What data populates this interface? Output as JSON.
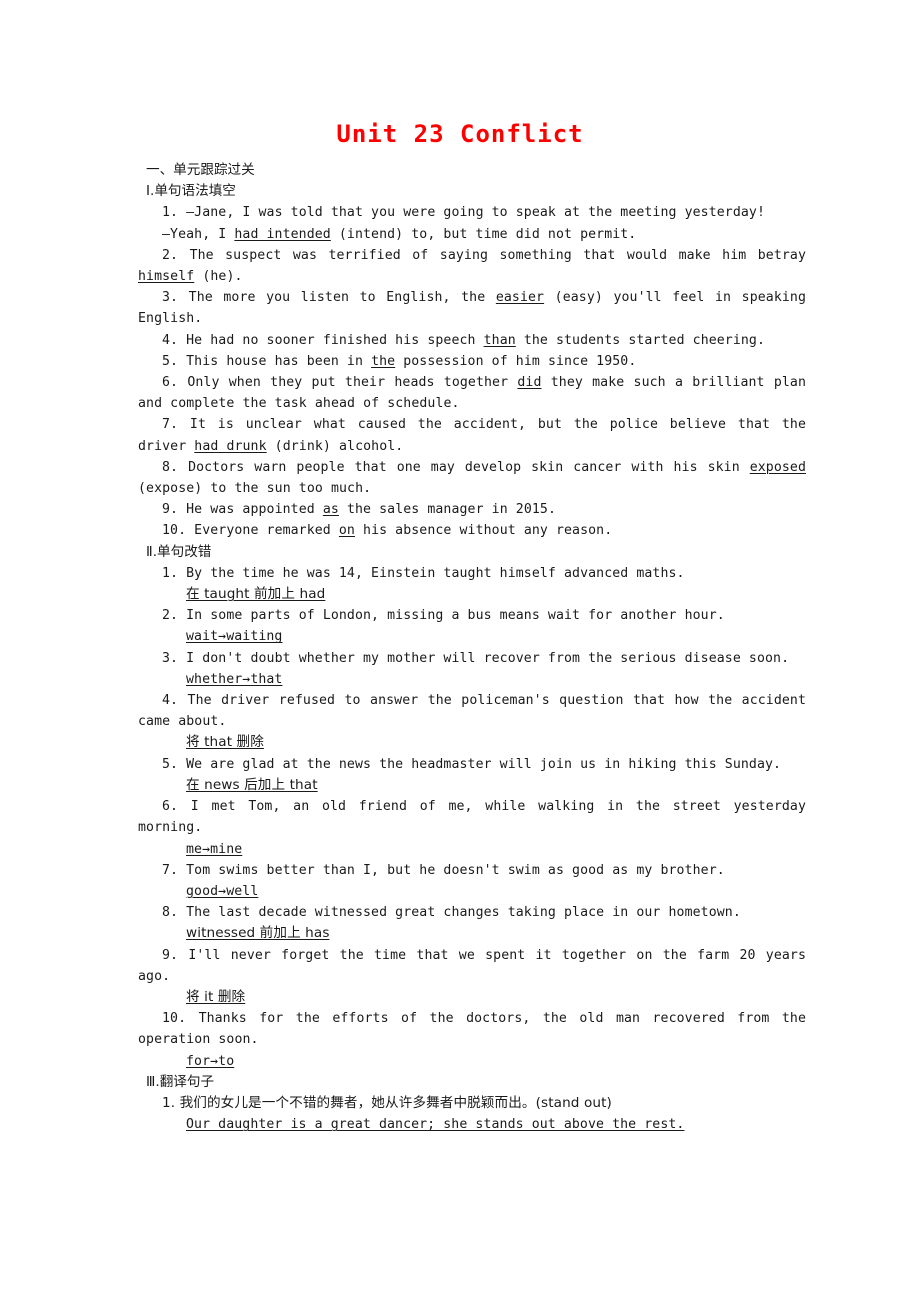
{
  "title": "Unit 23  Conflict",
  "title_color": "#ff0000",
  "section_one_heading": "一、单元跟踪过关",
  "part1": {
    "heading": "Ⅰ.单句语法填空",
    "items": [
      {
        "num": "1.",
        "text_before": "—Jane, I was told that you were going to speak at the meeting yesterday!",
        "line2_before": "—Yeah, I ",
        "answer": "had intended",
        "line2_after": " (intend) to, but time did not permit."
      },
      {
        "num": "2.",
        "before": "The suspect was terrified of saying something that would make him betray ",
        "answer": "himself",
        "after": " (he)."
      },
      {
        "num": "3.",
        "before": "The more you listen to English, the ",
        "answer": "easier",
        "after": " (easy) you'll feel in speaking English."
      },
      {
        "num": "4.",
        "before": "He had no sooner finished his speech  ",
        "answer": "than",
        "after": " the students started cheering."
      },
      {
        "num": "5.",
        "before": "This house has been in  ",
        "answer": "the",
        "after": " possession of him since 1950."
      },
      {
        "num": "6.",
        "before": "Only when they put their heads together ",
        "answer": "did",
        "after": " they make such a brilliant plan and complete the task ahead of schedule."
      },
      {
        "num": "7.",
        "before": "It is unclear what caused the accident, but the police believe that the driver ",
        "answer": "had drunk",
        "after": " (drink) alcohol."
      },
      {
        "num": "8.",
        "before": "Doctors warn people that one may develop skin cancer with his skin ",
        "answer": "exposed",
        "after": " (expose) to the sun too much."
      },
      {
        "num": "9.",
        "before": "He was appointed  ",
        "answer": "as",
        "after": " the sales manager in 2015."
      },
      {
        "num": "10.",
        "before": "Everyone remarked ",
        "answer": "on",
        "after": " his absence without any reason."
      }
    ]
  },
  "part2": {
    "heading": "Ⅱ.单句改错",
    "items": [
      {
        "num": "1.",
        "sentence": "By the time he was 14, Einstein taught himself advanced maths.",
        "answer": "在 taught 前加上 had",
        "answer_is_cn": true
      },
      {
        "num": "2.",
        "sentence": "In some parts of London, missing a bus means wait for another hour.",
        "answer": "wait→waiting",
        "answer_is_cn": false
      },
      {
        "num": "3.",
        "sentence": "I don't doubt whether my mother will recover from the serious disease soon.",
        "answer": "whether→that",
        "answer_is_cn": false
      },
      {
        "num": "4.",
        "sentence": "The driver refused to answer the policeman's question that how the accident came about.",
        "answer": "将 that 删除",
        "answer_is_cn": true
      },
      {
        "num": "5.",
        "sentence": "We are glad at the news the headmaster will join us in hiking this Sunday.",
        "answer": "在 news 后加上 that",
        "answer_is_cn": true
      },
      {
        "num": "6.",
        "sentence": "I met Tom, an old friend of me, while walking in the street yesterday morning.",
        "answer": "me→mine",
        "answer_is_cn": false
      },
      {
        "num": "7.",
        "sentence": "Tom swims better than I, but he doesn't swim as good as my brother.",
        "answer": "good→well",
        "answer_is_cn": false
      },
      {
        "num": "8.",
        "sentence": "The last decade witnessed great changes taking place in our hometown.",
        "answer": "witnessed 前加上 has",
        "answer_is_cn": true
      },
      {
        "num": "9.",
        "sentence": "I'll never forget the time that we spent it together on the farm 20 years ago.",
        "answer": "将 it 删除",
        "answer_is_cn": true
      },
      {
        "num": "10.",
        "sentence": "Thanks for the efforts of the doctors, the old man recovered from the operation soon.",
        "answer": "for→to",
        "answer_is_cn": false
      }
    ]
  },
  "part3": {
    "heading": "Ⅲ.翻译句子",
    "items": [
      {
        "num": "1.",
        "prompt": "我们的女儿是一个不错的舞者，她从许多舞者中脱颖而出。(stand out)",
        "answer": "Our daughter is a great dancer; she stands out above the rest."
      }
    ]
  }
}
